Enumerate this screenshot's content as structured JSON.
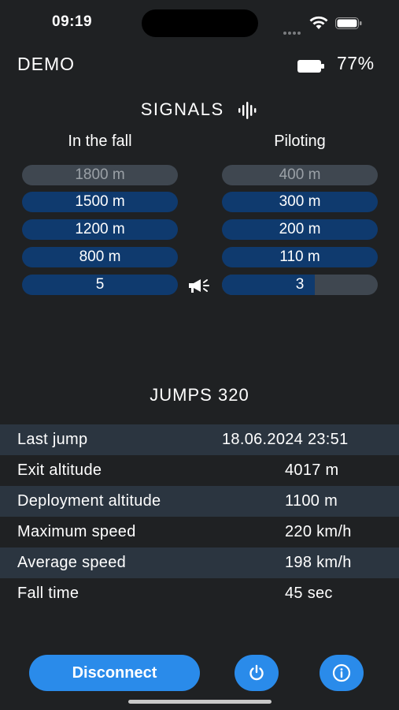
{
  "status": {
    "time": "09:19"
  },
  "header": {
    "title": "DEMO",
    "battery_percent": "77%"
  },
  "signals": {
    "title": "SIGNALS",
    "fall": {
      "label": "In the fall",
      "items": [
        "1800 m",
        "1500 m",
        "1200 m",
        "800 m"
      ],
      "count": "5"
    },
    "piloting": {
      "label": "Piloting",
      "items": [
        "400 m",
        "300 m",
        "200 m",
        "110 m"
      ],
      "count": "3"
    }
  },
  "jumps": {
    "title": "JUMPS 320",
    "rows": [
      {
        "key": "Last jump",
        "value": "18.06.2024 23:51"
      },
      {
        "key": "Exit altitude",
        "value": "4017 m"
      },
      {
        "key": "Deployment altitude",
        "value": "1100 m"
      },
      {
        "key": "Maximum speed",
        "value": "220 km/h"
      },
      {
        "key": "Average speed",
        "value": "198 km/h"
      },
      {
        "key": "Fall time",
        "value": "45 sec"
      }
    ]
  },
  "actions": {
    "disconnect": "Disconnect"
  },
  "icons": {
    "power": "power-icon",
    "info": "info-icon",
    "megaphone": "megaphone-icon",
    "waveform": "waveform-icon"
  },
  "colors": {
    "accent": "#2a8bea",
    "pill": "#0f3a6e",
    "pill_inactive": "#3f4750",
    "background": "#1f2123",
    "row_alt": "#2b3540"
  }
}
